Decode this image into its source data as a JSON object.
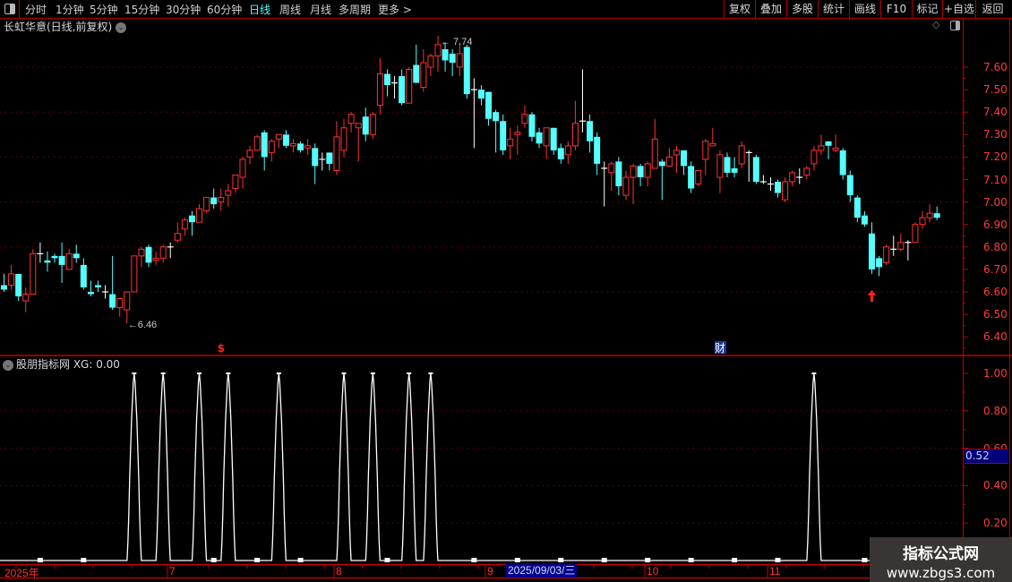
{
  "toolbar": {
    "periods": [
      "分时",
      "1分钟",
      "5分钟",
      "15分钟",
      "30分钟",
      "60分钟",
      "日线",
      "周线",
      "月线",
      "多周期",
      "更多 >"
    ],
    "active_period": "日线",
    "buttons": [
      "复权",
      "叠加",
      "多股",
      "统计",
      "画线",
      "F10",
      "标记",
      "+自选",
      "返回"
    ]
  },
  "chart_title": "长虹华意(日线,前复权)",
  "indicator_title": "股朋指标网 XG: 0.00",
  "current_value": "0.52",
  "markers": {
    "high_label": "7.74",
    "low_label": "6.46",
    "dollar": "$",
    "finance": "财"
  },
  "date_axis": {
    "labels": [
      "2025年",
      "7",
      "8",
      "9",
      "10",
      "11"
    ],
    "highlight": "2025/09/03/三"
  },
  "watermark": {
    "line1": "指标公式网",
    "line2": "www.zbgs3.com"
  },
  "colors": {
    "up": "#ff3232",
    "down": "#54ffff",
    "doji": "#ffffff",
    "axis": "#c00000",
    "indicator": "#ffffff"
  },
  "icons": {
    "layout": "layout-toggle-icon",
    "diamond": "diamond-icon",
    "collapse": "chevron-down-icon",
    "arrow": "up-arrow-icon"
  },
  "chart_data": [
    {
      "type": "candlestick",
      "title": "长虹华意(日线,前复权)",
      "yticks": [
        "7.60",
        "7.50",
        "7.40",
        "7.30",
        "7.20",
        "7.10",
        "7.00",
        "6.90",
        "6.80",
        "6.70",
        "6.60",
        "6.50",
        "6.40"
      ],
      "ylim": [
        6.36,
        7.78
      ],
      "grid": true,
      "ohlc": [
        [
          6.63,
          6.68,
          6.6,
          6.61
        ],
        [
          6.63,
          6.72,
          6.61,
          6.68
        ],
        [
          6.68,
          6.68,
          6.56,
          6.58
        ],
        [
          6.56,
          6.62,
          6.51,
          6.59
        ],
        [
          6.59,
          6.79,
          6.59,
          6.77
        ],
        [
          6.77,
          6.82,
          6.73,
          6.77
        ],
        [
          6.74,
          6.78,
          6.69,
          6.73
        ],
        [
          6.76,
          6.77,
          6.73,
          6.75
        ],
        [
          6.76,
          6.82,
          6.64,
          6.72
        ],
        [
          6.7,
          6.79,
          6.7,
          6.77
        ],
        [
          6.77,
          6.81,
          6.73,
          6.75
        ],
        [
          6.72,
          6.75,
          6.61,
          6.62
        ],
        [
          6.6,
          6.65,
          6.58,
          6.59
        ],
        [
          6.63,
          6.65,
          6.6,
          6.62
        ],
        [
          6.6,
          6.63,
          6.57,
          6.6
        ],
        [
          6.59,
          6.76,
          6.52,
          6.53
        ],
        [
          6.53,
          6.57,
          6.49,
          6.57
        ],
        [
          6.52,
          6.6,
          6.46,
          6.6
        ],
        [
          6.6,
          6.76,
          6.6,
          6.76
        ],
        [
          6.76,
          6.8,
          6.71,
          6.79
        ],
        [
          6.8,
          6.81,
          6.71,
          6.73
        ],
        [
          6.74,
          6.78,
          6.72,
          6.75
        ],
        [
          6.75,
          6.81,
          6.73,
          6.8
        ],
        [
          6.8,
          6.82,
          6.75,
          6.8
        ],
        [
          6.83,
          6.91,
          6.82,
          6.86
        ],
        [
          6.88,
          6.93,
          6.85,
          6.92
        ],
        [
          6.94,
          6.96,
          6.85,
          6.91
        ],
        [
          6.91,
          6.99,
          6.91,
          6.97
        ],
        [
          6.96,
          7.02,
          6.95,
          7.02
        ],
        [
          7.02,
          7.06,
          6.97,
          6.99
        ],
        [
          7.0,
          7.06,
          6.96,
          7.02
        ],
        [
          7.03,
          7.08,
          6.98,
          7.05
        ],
        [
          7.06,
          7.12,
          7.04,
          7.12
        ],
        [
          7.11,
          7.2,
          7.06,
          7.19
        ],
        [
          7.2,
          7.25,
          7.17,
          7.23
        ],
        [
          7.23,
          7.3,
          7.23,
          7.29
        ],
        [
          7.31,
          7.32,
          7.14,
          7.2
        ],
        [
          7.22,
          7.28,
          7.18,
          7.27
        ],
        [
          7.28,
          7.3,
          7.24,
          7.3
        ],
        [
          7.3,
          7.32,
          7.24,
          7.25
        ],
        [
          7.25,
          7.28,
          7.22,
          7.26
        ],
        [
          7.26,
          7.27,
          7.22,
          7.23
        ],
        [
          7.24,
          7.28,
          7.21,
          7.25
        ],
        [
          7.24,
          7.26,
          7.08,
          7.16
        ],
        [
          7.19,
          7.22,
          7.14,
          7.19
        ],
        [
          7.22,
          7.22,
          7.14,
          7.17
        ],
        [
          7.14,
          7.36,
          7.12,
          7.29
        ],
        [
          7.23,
          7.37,
          7.2,
          7.33
        ],
        [
          7.35,
          7.4,
          7.31,
          7.39
        ],
        [
          7.33,
          7.35,
          7.18,
          7.35
        ],
        [
          7.38,
          7.42,
          7.27,
          7.3
        ],
        [
          7.3,
          7.4,
          7.28,
          7.39
        ],
        [
          7.43,
          7.64,
          7.39,
          7.57
        ],
        [
          7.57,
          7.59,
          7.47,
          7.52
        ],
        [
          7.53,
          7.56,
          7.46,
          7.53
        ],
        [
          7.56,
          7.59,
          7.43,
          7.44
        ],
        [
          7.44,
          7.6,
          7.44,
          7.59
        ],
        [
          7.61,
          7.7,
          7.53,
          7.53
        ],
        [
          7.51,
          7.68,
          7.49,
          7.62
        ],
        [
          7.6,
          7.66,
          7.56,
          7.65
        ],
        [
          7.65,
          7.74,
          7.58,
          7.7
        ],
        [
          7.68,
          7.71,
          7.58,
          7.63
        ],
        [
          7.66,
          7.68,
          7.56,
          7.62
        ],
        [
          7.6,
          7.71,
          7.56,
          7.66
        ],
        [
          7.69,
          7.7,
          7.46,
          7.48
        ],
        [
          7.5,
          7.55,
          7.24,
          7.5
        ],
        [
          7.5,
          7.52,
          7.43,
          7.46
        ],
        [
          7.49,
          7.49,
          7.34,
          7.37
        ],
        [
          7.4,
          7.41,
          7.22,
          7.36
        ],
        [
          7.36,
          7.39,
          7.21,
          7.23
        ],
        [
          7.25,
          7.33,
          7.19,
          7.28
        ],
        [
          7.3,
          7.34,
          7.21,
          7.31
        ],
        [
          7.35,
          7.43,
          7.33,
          7.39
        ],
        [
          7.39,
          7.4,
          7.27,
          7.29
        ],
        [
          7.31,
          7.33,
          7.24,
          7.26
        ],
        [
          7.25,
          7.33,
          7.19,
          7.33
        ],
        [
          7.33,
          7.33,
          7.21,
          7.23
        ],
        [
          7.24,
          7.26,
          7.17,
          7.19
        ],
        [
          7.21,
          7.27,
          7.17,
          7.25
        ],
        [
          7.25,
          7.45,
          7.23,
          7.35
        ],
        [
          7.36,
          7.59,
          7.31,
          7.36
        ],
        [
          7.36,
          7.39,
          7.22,
          7.27
        ],
        [
          7.29,
          7.31,
          7.12,
          7.17
        ],
        [
          7.15,
          7.18,
          6.98,
          7.15
        ],
        [
          7.13,
          7.18,
          7.05,
          7.17
        ],
        [
          7.18,
          7.2,
          7.03,
          7.07
        ],
        [
          7.03,
          7.14,
          7.01,
          7.11
        ],
        [
          7.11,
          7.17,
          6.99,
          7.16
        ],
        [
          7.16,
          7.17,
          7.07,
          7.11
        ],
        [
          7.11,
          7.18,
          7.07,
          7.17
        ],
        [
          7.15,
          7.37,
          7.15,
          7.28
        ],
        [
          7.18,
          7.19,
          7.01,
          7.16
        ],
        [
          7.16,
          7.24,
          7.16,
          7.2
        ],
        [
          7.21,
          7.25,
          7.13,
          7.23
        ],
        [
          7.23,
          7.23,
          7.12,
          7.16
        ],
        [
          7.16,
          7.18,
          7.04,
          7.06
        ],
        [
          7.08,
          7.14,
          7.07,
          7.14
        ],
        [
          7.19,
          7.28,
          7.12,
          7.27
        ],
        [
          7.25,
          7.33,
          7.25,
          7.26
        ],
        [
          7.11,
          7.23,
          7.04,
          7.21
        ],
        [
          7.2,
          7.22,
          7.11,
          7.13
        ],
        [
          7.15,
          7.2,
          7.11,
          7.13
        ],
        [
          7.17,
          7.27,
          7.15,
          7.25
        ],
        [
          7.22,
          7.23,
          7.09,
          7.22
        ],
        [
          7.2,
          7.21,
          7.08,
          7.09
        ],
        [
          7.09,
          7.12,
          7.08,
          7.09
        ],
        [
          7.08,
          7.11,
          7.05,
          7.08
        ],
        [
          7.09,
          7.1,
          7.02,
          7.04
        ],
        [
          7.01,
          7.11,
          7.0,
          7.09
        ],
        [
          7.09,
          7.14,
          7.07,
          7.13
        ],
        [
          7.11,
          7.15,
          7.08,
          7.11
        ],
        [
          7.12,
          7.16,
          7.1,
          7.15
        ],
        [
          7.17,
          7.25,
          7.14,
          7.23
        ],
        [
          7.23,
          7.3,
          7.21,
          7.25
        ],
        [
          7.27,
          7.27,
          7.19,
          7.25
        ],
        [
          7.23,
          7.3,
          7.22,
          7.24
        ],
        [
          7.23,
          7.24,
          7.1,
          7.12
        ],
        [
          7.12,
          7.14,
          7.0,
          7.03
        ],
        [
          7.02,
          7.03,
          6.91,
          6.93
        ],
        [
          6.94,
          6.96,
          6.89,
          6.9
        ],
        [
          6.86,
          6.91,
          6.68,
          6.7
        ],
        [
          6.75,
          6.76,
          6.67,
          6.71
        ],
        [
          6.73,
          6.81,
          6.72,
          6.8
        ],
        [
          6.79,
          6.85,
          6.76,
          6.79
        ],
        [
          6.79,
          6.86,
          6.78,
          6.82
        ],
        [
          6.82,
          6.83,
          6.74,
          6.82
        ],
        [
          6.82,
          6.91,
          6.82,
          6.9
        ],
        [
          6.9,
          6.96,
          6.88,
          6.93
        ],
        [
          6.93,
          6.99,
          6.91,
          6.95
        ],
        [
          6.95,
          6.98,
          6.92,
          6.93
        ]
      ],
      "high": {
        "bar": 60,
        "value": 7.74
      },
      "low": {
        "bar": 17,
        "value": 6.46
      },
      "buy_arrow_bar": 120,
      "dollar_marker_bar": 30,
      "finance_marker_bar": 99
    },
    {
      "type": "line",
      "title": "股朋指标网",
      "series": [
        {
          "name": "XG",
          "signal_bars": [
            18,
            22,
            27,
            31,
            38,
            47,
            51,
            56,
            59,
            112
          ]
        }
      ],
      "yticks": [
        "1.00",
        "0.80",
        "0.60",
        "0.40",
        "0.20"
      ],
      "ylim": [
        0,
        1.05
      ],
      "grid": true
    }
  ]
}
